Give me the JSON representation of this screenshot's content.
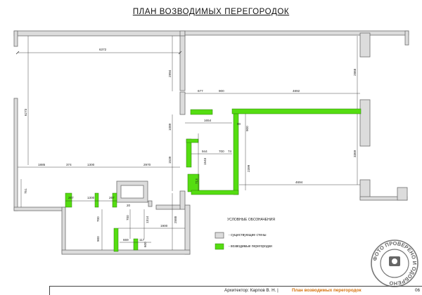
{
  "sheet": {
    "title": "ПЛАН   ВОЗВОДИМЫХ   ПЕРЕГОРОДОК",
    "legend_title": "УСЛОВНЫЕ  ОБОЗНАЧЕНИЯ",
    "legend_existing": "-  существующие  стены",
    "legend_new": "-  возводимые  перегородки",
    "architect": "Архитектор:   Карпов   В. Н. |",
    "plan_name": "План возводимых перегородок",
    "sheet_number": "06",
    "stamp_text": "ФОТО ПРОВЕРЕНО И ОДОБРЕНО",
    "colors": {
      "existing_wall": "#dcdcdc",
      "new_partition": "#55dd11",
      "plan_name": "#d4700a"
    }
  },
  "dimensions": {
    "d6372": "6372",
    "d6273": "6273",
    "d2994": "2994",
    "d2868": "2868",
    "d677": "677",
    "d900a": "900",
    "d4892": "4892",
    "d1654": "1654",
    "d90": "90",
    "d900b": "900",
    "d1089": "1089",
    "d944": "944",
    "d700a": "700",
    "d74": "74",
    "d1543": "1543",
    "d1539": "1539",
    "d2399": "2399",
    "d3369": "3369",
    "d713": "713",
    "d1885": "1885",
    "d374": "374",
    "d1300a": "1300",
    "d2970": "2970",
    "d751": "751",
    "d267a": "267",
    "d1300b": "1300",
    "d267b": "267",
    "d4694": "4694",
    "d2588": "2588",
    "d1314": "1314",
    "d1900": "1900",
    "d700b": "700",
    "d700c": "700",
    "d900c": "900",
    "d669": "669",
    "d117": "117",
    "d600": "600",
    "d20": "20"
  }
}
